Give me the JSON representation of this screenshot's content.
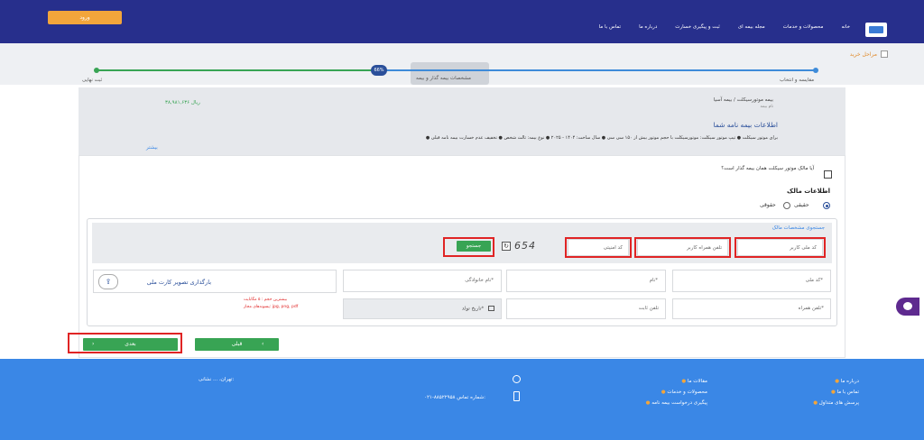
{
  "header": {
    "login_label": "ورود",
    "nav": [
      "خانه",
      "محصولات و خدمات",
      "مجله بیمه ای",
      "ثبت و پیگیری خسارت",
      "درباره ما",
      "تماس با ما"
    ]
  },
  "stages": {
    "label": "مراحل خرید",
    "step_left": "ثبت نهایی",
    "step_current": "مشخصات بیمه گذار و بیمه",
    "step_right": "مقایسه و انتخاب",
    "percent": "66%"
  },
  "info": {
    "breadcrumb": "بیمه موتورسیکلت / بیمه آسیا",
    "sub": "نام بیمه",
    "price": "۳۸,۹۸۱,۶۳۶ ریال",
    "title": "اطلاعات بیمه نامه شما",
    "details": "● برای موتور سیکلت ● تیپ موتور سیکلت: موتورسیکلت با حجم موتور بیش از ۱۵۰ سی سی ● سال ساخت: ۱۴۰۴ - ۲۰۲۵ ● نوع بیمه: ثالث شخص ● تخفیف عدم خسارت بیمه نامه قبلی",
    "more": "بیشتر"
  },
  "owner": {
    "checkbox_label": "آیا مالک موتور سیکلت همان بیمه گذار است؟",
    "section_title": "اطلاعات مالک",
    "radio_real": "حقیقی",
    "radio_legal": "حقوقی"
  },
  "search": {
    "title": "جستجوی مشخصات مالک",
    "national_code_placeholder": "کد ملی کاربر",
    "phone_placeholder": "تلفن همراه کاربر",
    "captcha_placeholder": "کد امنیتی",
    "captcha_text": "654",
    "search_label": "جستجو"
  },
  "form": {
    "national_code": "کد ملی*",
    "first_name": "نام*",
    "last_name": "نام خانوادگی*",
    "upload_label": "بارگذاری تصویر کارت ملی",
    "mobile": "تلفن همراه*",
    "landline": "تلفن ثابت",
    "birth_date": "تاریخ تولد*",
    "upload_hint_1": "بیشترین حجم : ۵ مگابایت",
    "upload_hint_2": "پسوندهای مجاز: jpg, png, pdf"
  },
  "buttons": {
    "prev": "قبلی",
    "next": "بعدی"
  },
  "footer": {
    "links_col1": [
      "درباره ما",
      "تماس با ما",
      "پرسش های متداول"
    ],
    "links_col2": [
      "مقالات ما",
      "محصولات و خدمات",
      "پیگیری درخواست بیمه نامه"
    ],
    "address_label": "نشانی:",
    "address": "تهران، ...",
    "phone_label": "شماره تماس:",
    "phone": "۰۲۱-۸۸۵۲۲۹۵۸"
  },
  "colors": {
    "header": "#272f8c",
    "accent_orange": "#f2a53b",
    "green": "#38a454",
    "footer": "#3a87e6",
    "highlight_red": "#e02424"
  }
}
